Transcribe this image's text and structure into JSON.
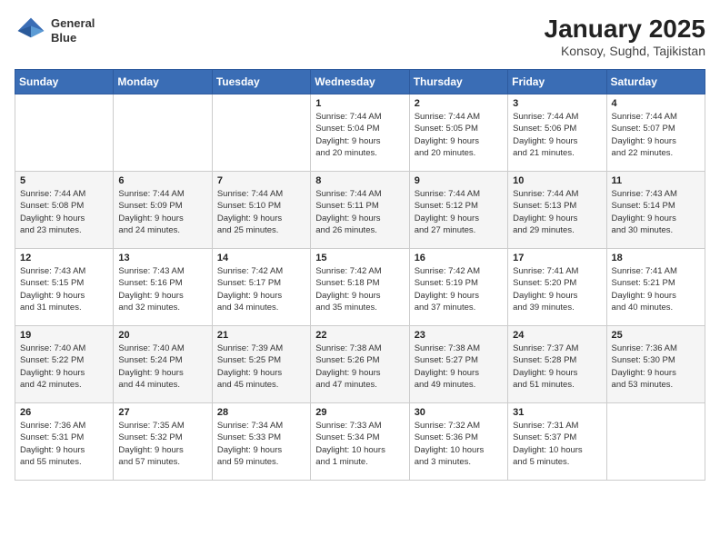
{
  "header": {
    "logo_line1": "General",
    "logo_line2": "Blue",
    "title": "January 2025",
    "subtitle": "Konsoy, Sughd, Tajikistan"
  },
  "calendar": {
    "days_of_week": [
      "Sunday",
      "Monday",
      "Tuesday",
      "Wednesday",
      "Thursday",
      "Friday",
      "Saturday"
    ],
    "weeks": [
      [
        {
          "day": "",
          "info": ""
        },
        {
          "day": "",
          "info": ""
        },
        {
          "day": "",
          "info": ""
        },
        {
          "day": "1",
          "info": "Sunrise: 7:44 AM\nSunset: 5:04 PM\nDaylight: 9 hours\nand 20 minutes."
        },
        {
          "day": "2",
          "info": "Sunrise: 7:44 AM\nSunset: 5:05 PM\nDaylight: 9 hours\nand 20 minutes."
        },
        {
          "day": "3",
          "info": "Sunrise: 7:44 AM\nSunset: 5:06 PM\nDaylight: 9 hours\nand 21 minutes."
        },
        {
          "day": "4",
          "info": "Sunrise: 7:44 AM\nSunset: 5:07 PM\nDaylight: 9 hours\nand 22 minutes."
        }
      ],
      [
        {
          "day": "5",
          "info": "Sunrise: 7:44 AM\nSunset: 5:08 PM\nDaylight: 9 hours\nand 23 minutes."
        },
        {
          "day": "6",
          "info": "Sunrise: 7:44 AM\nSunset: 5:09 PM\nDaylight: 9 hours\nand 24 minutes."
        },
        {
          "day": "7",
          "info": "Sunrise: 7:44 AM\nSunset: 5:10 PM\nDaylight: 9 hours\nand 25 minutes."
        },
        {
          "day": "8",
          "info": "Sunrise: 7:44 AM\nSunset: 5:11 PM\nDaylight: 9 hours\nand 26 minutes."
        },
        {
          "day": "9",
          "info": "Sunrise: 7:44 AM\nSunset: 5:12 PM\nDaylight: 9 hours\nand 27 minutes."
        },
        {
          "day": "10",
          "info": "Sunrise: 7:44 AM\nSunset: 5:13 PM\nDaylight: 9 hours\nand 29 minutes."
        },
        {
          "day": "11",
          "info": "Sunrise: 7:43 AM\nSunset: 5:14 PM\nDaylight: 9 hours\nand 30 minutes."
        }
      ],
      [
        {
          "day": "12",
          "info": "Sunrise: 7:43 AM\nSunset: 5:15 PM\nDaylight: 9 hours\nand 31 minutes."
        },
        {
          "day": "13",
          "info": "Sunrise: 7:43 AM\nSunset: 5:16 PM\nDaylight: 9 hours\nand 32 minutes."
        },
        {
          "day": "14",
          "info": "Sunrise: 7:42 AM\nSunset: 5:17 PM\nDaylight: 9 hours\nand 34 minutes."
        },
        {
          "day": "15",
          "info": "Sunrise: 7:42 AM\nSunset: 5:18 PM\nDaylight: 9 hours\nand 35 minutes."
        },
        {
          "day": "16",
          "info": "Sunrise: 7:42 AM\nSunset: 5:19 PM\nDaylight: 9 hours\nand 37 minutes."
        },
        {
          "day": "17",
          "info": "Sunrise: 7:41 AM\nSunset: 5:20 PM\nDaylight: 9 hours\nand 39 minutes."
        },
        {
          "day": "18",
          "info": "Sunrise: 7:41 AM\nSunset: 5:21 PM\nDaylight: 9 hours\nand 40 minutes."
        }
      ],
      [
        {
          "day": "19",
          "info": "Sunrise: 7:40 AM\nSunset: 5:22 PM\nDaylight: 9 hours\nand 42 minutes."
        },
        {
          "day": "20",
          "info": "Sunrise: 7:40 AM\nSunset: 5:24 PM\nDaylight: 9 hours\nand 44 minutes."
        },
        {
          "day": "21",
          "info": "Sunrise: 7:39 AM\nSunset: 5:25 PM\nDaylight: 9 hours\nand 45 minutes."
        },
        {
          "day": "22",
          "info": "Sunrise: 7:38 AM\nSunset: 5:26 PM\nDaylight: 9 hours\nand 47 minutes."
        },
        {
          "day": "23",
          "info": "Sunrise: 7:38 AM\nSunset: 5:27 PM\nDaylight: 9 hours\nand 49 minutes."
        },
        {
          "day": "24",
          "info": "Sunrise: 7:37 AM\nSunset: 5:28 PM\nDaylight: 9 hours\nand 51 minutes."
        },
        {
          "day": "25",
          "info": "Sunrise: 7:36 AM\nSunset: 5:30 PM\nDaylight: 9 hours\nand 53 minutes."
        }
      ],
      [
        {
          "day": "26",
          "info": "Sunrise: 7:36 AM\nSunset: 5:31 PM\nDaylight: 9 hours\nand 55 minutes."
        },
        {
          "day": "27",
          "info": "Sunrise: 7:35 AM\nSunset: 5:32 PM\nDaylight: 9 hours\nand 57 minutes."
        },
        {
          "day": "28",
          "info": "Sunrise: 7:34 AM\nSunset: 5:33 PM\nDaylight: 9 hours\nand 59 minutes."
        },
        {
          "day": "29",
          "info": "Sunrise: 7:33 AM\nSunset: 5:34 PM\nDaylight: 10 hours\nand 1 minute."
        },
        {
          "day": "30",
          "info": "Sunrise: 7:32 AM\nSunset: 5:36 PM\nDaylight: 10 hours\nand 3 minutes."
        },
        {
          "day": "31",
          "info": "Sunrise: 7:31 AM\nSunset: 5:37 PM\nDaylight: 10 hours\nand 5 minutes."
        },
        {
          "day": "",
          "info": ""
        }
      ]
    ]
  }
}
